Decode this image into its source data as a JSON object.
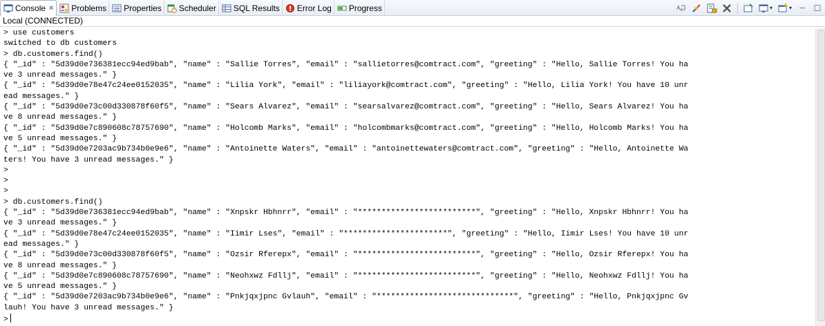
{
  "tabs": [
    {
      "label": "Console",
      "icon": "console-icon",
      "active": true,
      "close": "✕"
    },
    {
      "label": "Problems",
      "icon": "problems-icon"
    },
    {
      "label": "Properties",
      "icon": "properties-icon"
    },
    {
      "label": "Scheduler",
      "icon": "scheduler-icon"
    },
    {
      "label": "SQL Results",
      "icon": "sql-results-icon"
    },
    {
      "label": "Error Log",
      "icon": "error-log-icon"
    },
    {
      "label": "Progress",
      "icon": "progress-icon"
    }
  ],
  "toolbar": {
    "icons": [
      "word-wrap-icon",
      "disconnect-icon",
      "scroll-lock-icon",
      "clear-console-icon",
      "pin-console-icon",
      "display-console-icon",
      "new-console-icon",
      "minimize-icon",
      "maximize-icon"
    ],
    "minimize_glyph": "─",
    "maximize_glyph": "☐",
    "dropdown_glyph": "▾"
  },
  "status": {
    "text": "Local (CONNECTED)"
  },
  "console": {
    "lines": [
      "> use customers",
      "switched to db customers",
      "> db.customers.find()",
      "{ \"_id\" : \"5d39d0e736381ecc94ed9bab\", \"name\" : \"Sallie Torres\", \"email\" : \"sallietorres@comtract.com\", \"greeting\" : \"Hello, Sallie Torres! You ha",
      "ve 3 unread messages.\" }",
      "{ \"_id\" : \"5d39d0e78e47c24ee0152035\", \"name\" : \"Lilia York\", \"email\" : \"liliayork@comtract.com\", \"greeting\" : \"Hello, Lilia York! You have 10 unr",
      "ead messages.\" }",
      "{ \"_id\" : \"5d39d0e73c00d330878f60f5\", \"name\" : \"Sears Alvarez\", \"email\" : \"searsalvarez@comtract.com\", \"greeting\" : \"Hello, Sears Alvarez! You ha",
      "ve 8 unread messages.\" }",
      "{ \"_id\" : \"5d39d0e7c890608c78757690\", \"name\" : \"Holcomb Marks\", \"email\" : \"holcombmarks@comtract.com\", \"greeting\" : \"Hello, Holcomb Marks! You ha",
      "ve 5 unread messages.\" }",
      "{ \"_id\" : \"5d39d0e7203ac9b734b0e9e6\", \"name\" : \"Antoinette Waters\", \"email\" : \"antoinettewaters@comtract.com\", \"greeting\" : \"Hello, Antoinette Wa",
      "ters! You have 3 unread messages.\" }",
      ">",
      ">",
      ">",
      "> db.customers.find()",
      "{ \"_id\" : \"5d39d0e736381ecc94ed9bab\", \"name\" : \"Xnpskr Hbhnrr\", \"email\" : \"*************************\", \"greeting\" : \"Hello, Xnpskr Hbhnrr! You ha",
      "ve 3 unread messages.\" }",
      "{ \"_id\" : \"5d39d0e78e47c24ee0152035\", \"name\" : \"Iimir Lses\", \"email\" : \"**********************\", \"greeting\" : \"Hello, Iimir Lses! You have 10 unr",
      "ead messages.\" }",
      "{ \"_id\" : \"5d39d0e73c00d330878f60f5\", \"name\" : \"Ozsir Rferepx\", \"email\" : \"*************************\", \"greeting\" : \"Hello, Ozsir Rferepx! You ha",
      "ve 8 unread messages.\" }",
      "{ \"_id\" : \"5d39d0e7c890608c78757690\", \"name\" : \"Neohxwz Fdllj\", \"email\" : \"*************************\", \"greeting\" : \"Hello, Neohxwz Fdllj! You ha",
      "ve 5 unread messages.\" }",
      "{ \"_id\" : \"5d39d0e7203ac9b734b0e9e6\", \"name\" : \"Pnkjqxjpnc Gvlauh\", \"email\" : \"*****************************\", \"greeting\" : \"Hello, Pnkjqxjpnc Gv",
      "lauh! You have 3 unread messages.\" }"
    ],
    "prompt": ">"
  }
}
